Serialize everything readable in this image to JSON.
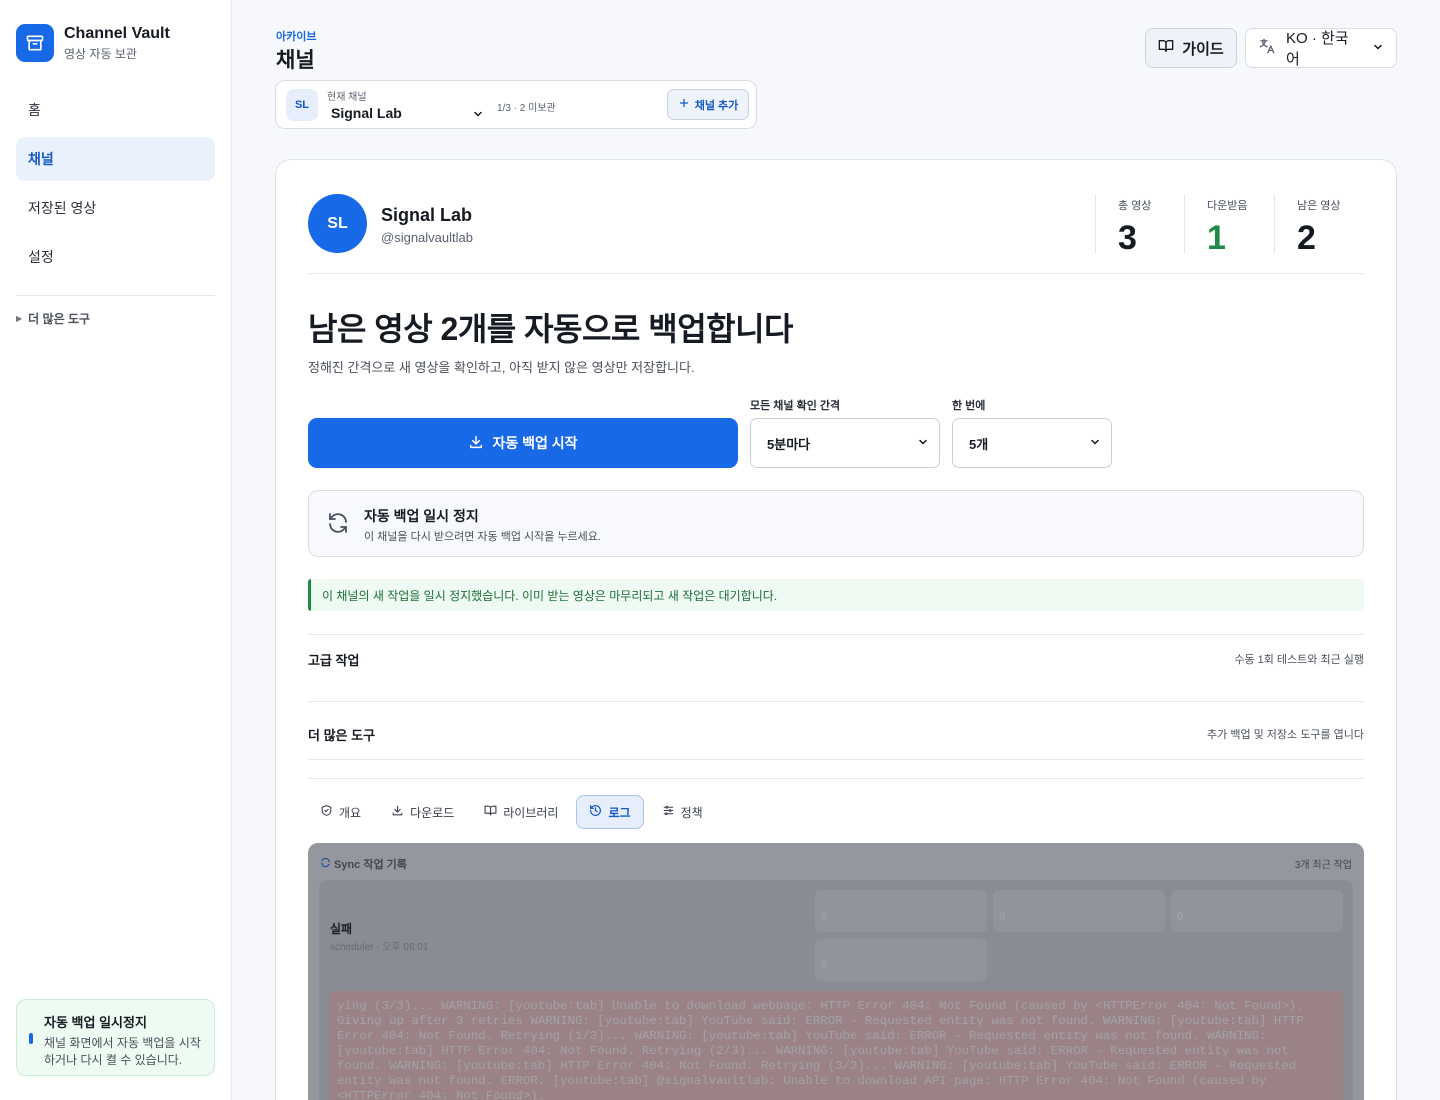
{
  "brand": {
    "title": "Channel Vault",
    "subtitle": "영상 자동 보관"
  },
  "nav": {
    "items": [
      {
        "label": "홈"
      },
      {
        "label": "채널"
      },
      {
        "label": "저장된 영상"
      },
      {
        "label": "설정"
      }
    ],
    "active": "채널"
  },
  "sidebar": {
    "more_tools": "더 많은 도구"
  },
  "status_card": {
    "title": "자동 백업 일시정지",
    "description": "채널 화면에서 자동 백업을 시작하거나 다시 켤 수 있습니다."
  },
  "header": {
    "breadcrumb": "아카이브",
    "title": "채널",
    "guide_label": "가이드",
    "language_label": "KO · 한국어"
  },
  "channel_selector": {
    "label": "현재 채널",
    "badge": "SL",
    "name": "Signal Lab",
    "count": "1/3 · 2 미보관",
    "add_label": "채널 추가"
  },
  "channel": {
    "avatar": "SL",
    "name": "Signal Lab",
    "handle": "@signalvaultlab",
    "stats": [
      {
        "label": "총 영상",
        "value": "3"
      },
      {
        "label": "다운받음",
        "value": "1"
      },
      {
        "label": "남은 영상",
        "value": "2"
      }
    ]
  },
  "backup": {
    "headline": "남은 영상 2개를 자동으로 백업합니다",
    "subline": "정해진 간격으로 새 영상을 확인하고, 아직 받지 않은 영상만 저장합니다.",
    "start_label": "자동 백업 시작",
    "interval_label": "모든 채널 확인 간격",
    "interval_value": "5분마다",
    "batch_label": "한 번에",
    "batch_value": "5개"
  },
  "paused": {
    "title": "자동 백업 일시 정지",
    "description": "이 채널을 다시 받으려면 자동 백업 시작을 누르세요."
  },
  "notice": "이 채널의 새 작업을 일시 정지했습니다. 이미 받는 영상은 마무리되고 새 작업은 대기합니다.",
  "sections": [
    {
      "title": "고급 작업",
      "hint": "수동 1회 테스트와 최근 실행"
    },
    {
      "title": "더 많은 도구",
      "hint": "추가 백업 및 저장소 도구를 엽니다"
    }
  ],
  "tabs": [
    {
      "label": "개요"
    },
    {
      "label": "다운로드"
    },
    {
      "label": "라이브러리"
    },
    {
      "label": "로그"
    },
    {
      "label": "정책"
    }
  ],
  "active_tab": "로그",
  "log": {
    "title": "Sync 작업 기록",
    "count": "3개 최근 작업",
    "entry": {
      "status": "실패",
      "meta": "scheduler · 오후 08:01",
      "metrics": [
        {
          "value": "0"
        },
        {
          "value": "0"
        },
        {
          "value": "0"
        },
        {
          "value": "0"
        }
      ],
      "error": "ying (3/3)... WARNING: [youtube:tab] Unable to download webpage: HTTP Error 404: Not Found (caused by <HTTPError 404: Not Found>). Giving up after 3 retries WARNING: [youtube:tab] YouTube said: ERROR - Requested entity was not found. WARNING: [youtube:tab] HTTP Error 404: Not Found. Retrying (1/3)... WARNING: [youtube:tab] YouTube said: ERROR - Requested entity was not found. WARNING: [youtube:tab] HTTP Error 404: Not Found. Retrying (2/3)... WARNING: [youtube:tab] YouTube said: ERROR - Requested entity was not found. WARNING: [youtube:tab] HTTP Error 404: Not Found. Retrying (3/3)... WARNING: [youtube:tab] YouTube said: ERROR - Requested entity was not found. ERROR: [youtube:tab] @signalvaultlab: Unable to download API page: HTTP Error 404: Not Found (caused by <HTTPError 404: Not Found>)."
    }
  },
  "colors": {
    "accent": "#1769e8",
    "success": "#1f8a45"
  }
}
